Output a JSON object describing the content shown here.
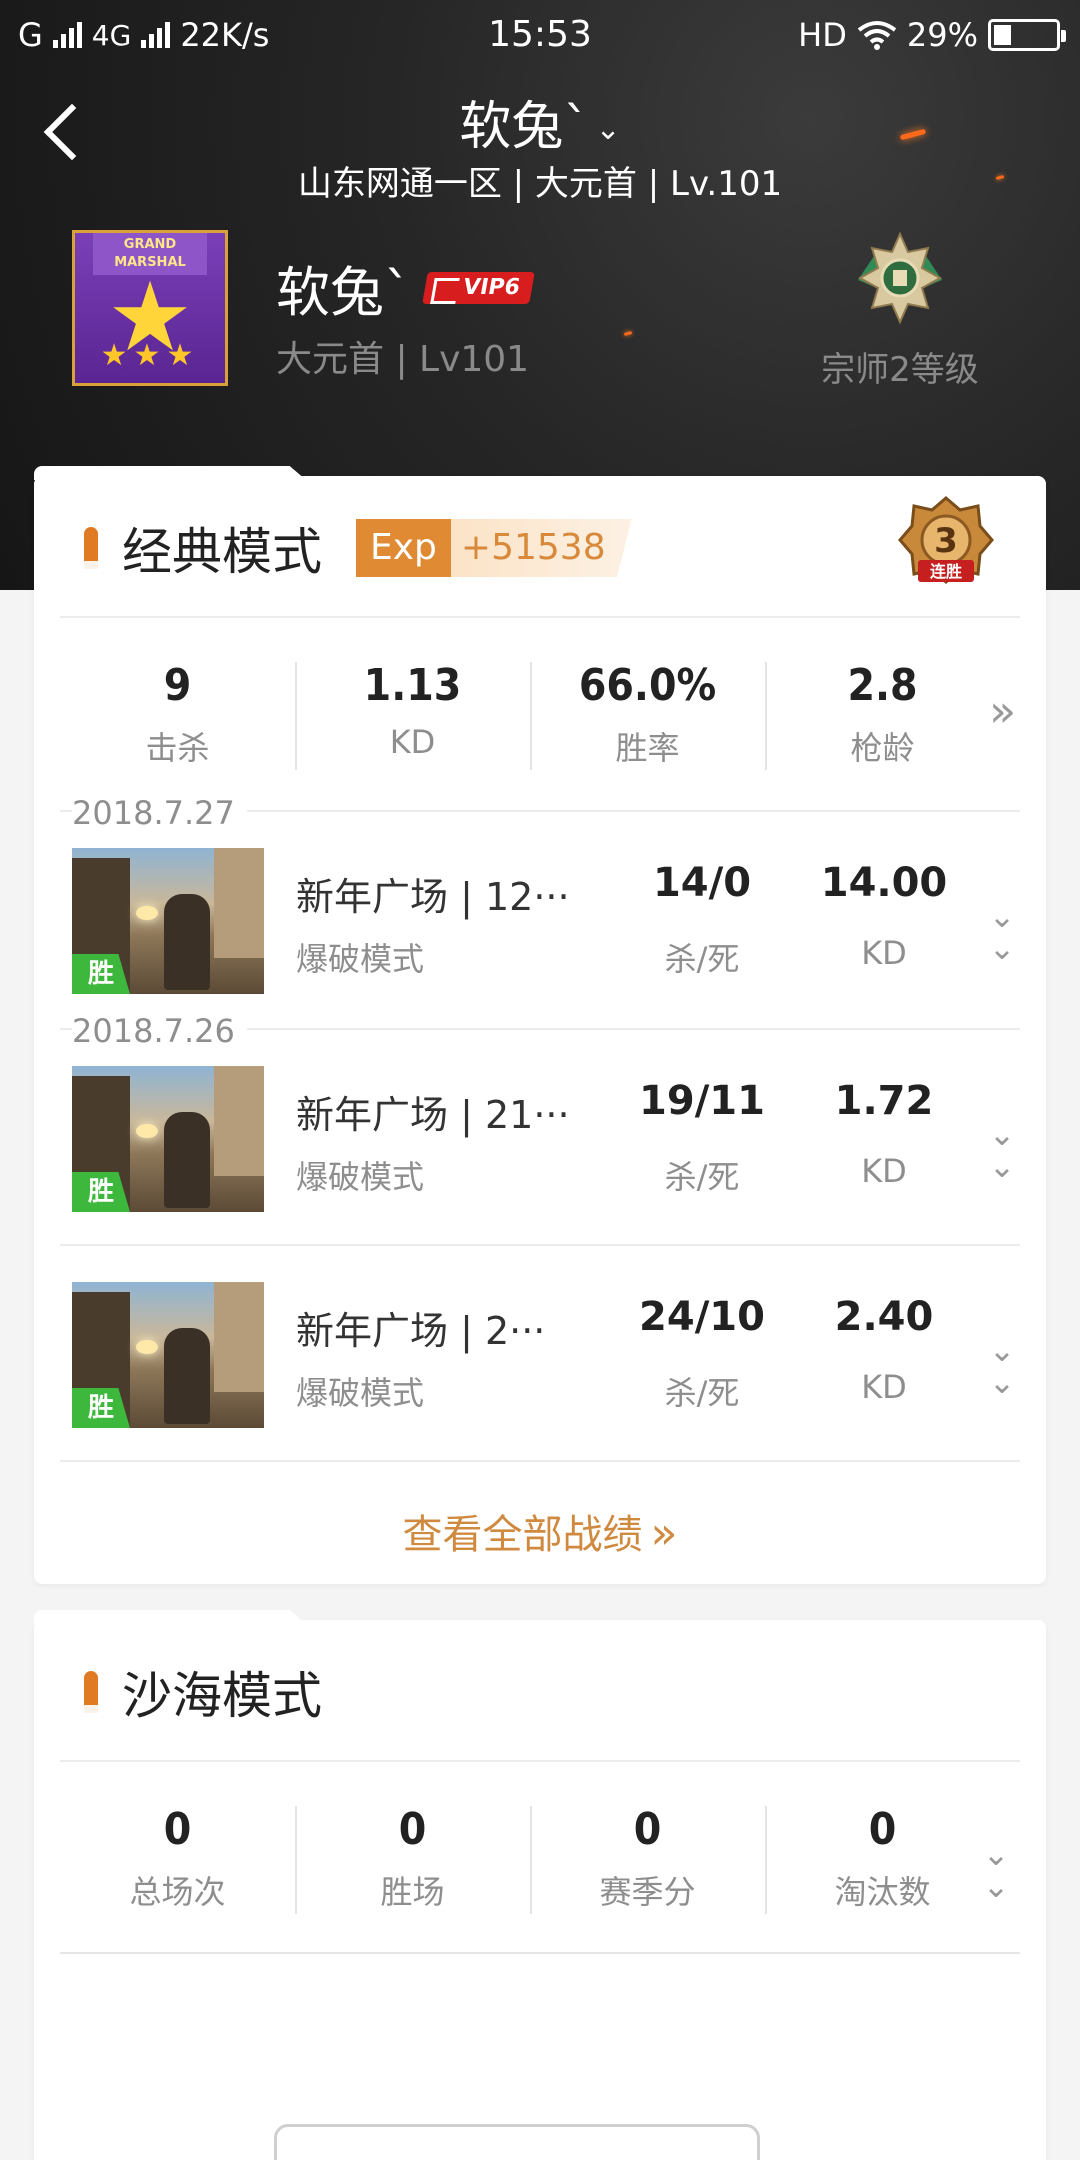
{
  "status_bar": {
    "carrier": "G",
    "network": "4G",
    "speed": "22K/s",
    "time": "15:53",
    "hd": "HD",
    "battery": "29%",
    "battery_level": 0.29
  },
  "header": {
    "title": "软兔`",
    "subtitle": "山东网通一区 | 大元首 | Lv.101",
    "avatar_ribbon": "GRAND MARSHAL",
    "username": "软兔`",
    "vip": "VIP6",
    "meta": "大元首 | Lv101",
    "rank": "宗师2等级"
  },
  "classic": {
    "title": "经典模式",
    "exp_label": "Exp",
    "exp_value": "+51538",
    "streak_num": "3",
    "streak_label": "连胜",
    "stats": [
      {
        "value": "9",
        "label": "击杀"
      },
      {
        "value": "1.13",
        "label": "KD"
      },
      {
        "value": "66.0%",
        "label": "胜率"
      },
      {
        "value": "2.8",
        "label": "枪龄"
      }
    ],
    "matches": [
      {
        "date": "2018.7.27",
        "name": "新年广场 | 12···",
        "mode": "爆破模式",
        "kd": "14/0",
        "kd_label": "杀/死",
        "ratio": "14.00",
        "ratio_label": "KD",
        "result": "胜"
      },
      {
        "date": "2018.7.26",
        "name": "新年广场 | 21···",
        "mode": "爆破模式",
        "kd": "19/11",
        "kd_label": "杀/死",
        "ratio": "1.72",
        "ratio_label": "KD",
        "result": "胜"
      },
      {
        "date": "",
        "name": "新年广场 | 2···",
        "mode": "爆破模式",
        "kd": "24/10",
        "kd_label": "杀/死",
        "ratio": "2.40",
        "ratio_label": "KD",
        "result": "胜"
      }
    ],
    "view_all": "查看全部战绩"
  },
  "desert": {
    "title": "沙海模式",
    "stats": [
      {
        "value": "0",
        "label": "总场次"
      },
      {
        "value": "0",
        "label": "胜场"
      },
      {
        "value": "0",
        "label": "赛季分"
      },
      {
        "value": "0",
        "label": "淘汰数"
      }
    ]
  },
  "colors": {
    "accent": "#e07b23",
    "link": "#d08a40",
    "win": "#3db73c",
    "vip": "#d71d1d"
  }
}
